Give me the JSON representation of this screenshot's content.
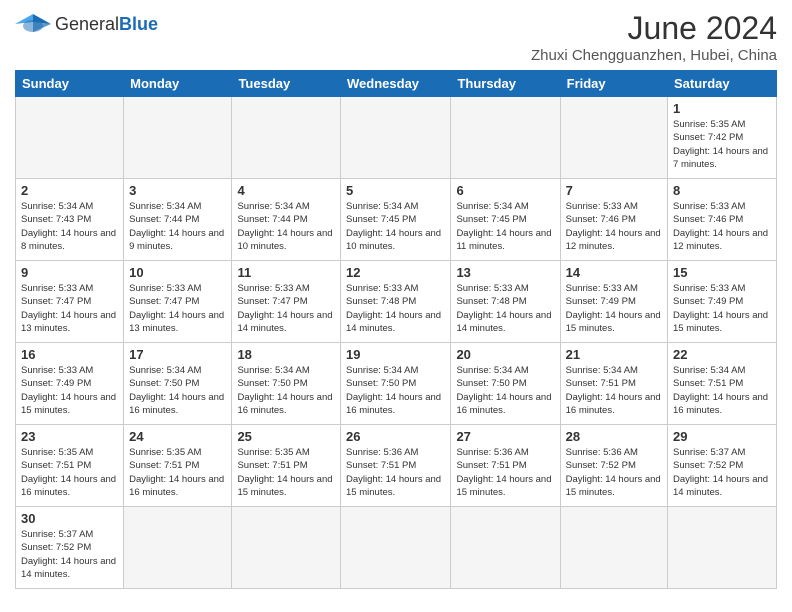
{
  "header": {
    "logo_general": "General",
    "logo_blue": "Blue",
    "month_year": "June 2024",
    "location": "Zhuxi Chengguanzhen, Hubei, China"
  },
  "weekdays": [
    "Sunday",
    "Monday",
    "Tuesday",
    "Wednesday",
    "Thursday",
    "Friday",
    "Saturday"
  ],
  "weeks": [
    [
      {
        "day": "",
        "info": ""
      },
      {
        "day": "",
        "info": ""
      },
      {
        "day": "",
        "info": ""
      },
      {
        "day": "",
        "info": ""
      },
      {
        "day": "",
        "info": ""
      },
      {
        "day": "",
        "info": ""
      },
      {
        "day": "1",
        "info": "Sunrise: 5:35 AM\nSunset: 7:42 PM\nDaylight: 14 hours\nand 7 minutes."
      }
    ],
    [
      {
        "day": "2",
        "info": "Sunrise: 5:34 AM\nSunset: 7:43 PM\nDaylight: 14 hours\nand 8 minutes."
      },
      {
        "day": "3",
        "info": "Sunrise: 5:34 AM\nSunset: 7:44 PM\nDaylight: 14 hours\nand 9 minutes."
      },
      {
        "day": "4",
        "info": "Sunrise: 5:34 AM\nSunset: 7:44 PM\nDaylight: 14 hours\nand 10 minutes."
      },
      {
        "day": "5",
        "info": "Sunrise: 5:34 AM\nSunset: 7:45 PM\nDaylight: 14 hours\nand 10 minutes."
      },
      {
        "day": "6",
        "info": "Sunrise: 5:34 AM\nSunset: 7:45 PM\nDaylight: 14 hours\nand 11 minutes."
      },
      {
        "day": "7",
        "info": "Sunrise: 5:33 AM\nSunset: 7:46 PM\nDaylight: 14 hours\nand 12 minutes."
      },
      {
        "day": "8",
        "info": "Sunrise: 5:33 AM\nSunset: 7:46 PM\nDaylight: 14 hours\nand 12 minutes."
      }
    ],
    [
      {
        "day": "9",
        "info": "Sunrise: 5:33 AM\nSunset: 7:47 PM\nDaylight: 14 hours\nand 13 minutes."
      },
      {
        "day": "10",
        "info": "Sunrise: 5:33 AM\nSunset: 7:47 PM\nDaylight: 14 hours\nand 13 minutes."
      },
      {
        "day": "11",
        "info": "Sunrise: 5:33 AM\nSunset: 7:47 PM\nDaylight: 14 hours\nand 14 minutes."
      },
      {
        "day": "12",
        "info": "Sunrise: 5:33 AM\nSunset: 7:48 PM\nDaylight: 14 hours\nand 14 minutes."
      },
      {
        "day": "13",
        "info": "Sunrise: 5:33 AM\nSunset: 7:48 PM\nDaylight: 14 hours\nand 14 minutes."
      },
      {
        "day": "14",
        "info": "Sunrise: 5:33 AM\nSunset: 7:49 PM\nDaylight: 14 hours\nand 15 minutes."
      },
      {
        "day": "15",
        "info": "Sunrise: 5:33 AM\nSunset: 7:49 PM\nDaylight: 14 hours\nand 15 minutes."
      }
    ],
    [
      {
        "day": "16",
        "info": "Sunrise: 5:33 AM\nSunset: 7:49 PM\nDaylight: 14 hours\nand 15 minutes."
      },
      {
        "day": "17",
        "info": "Sunrise: 5:34 AM\nSunset: 7:50 PM\nDaylight: 14 hours\nand 16 minutes."
      },
      {
        "day": "18",
        "info": "Sunrise: 5:34 AM\nSunset: 7:50 PM\nDaylight: 14 hours\nand 16 minutes."
      },
      {
        "day": "19",
        "info": "Sunrise: 5:34 AM\nSunset: 7:50 PM\nDaylight: 14 hours\nand 16 minutes."
      },
      {
        "day": "20",
        "info": "Sunrise: 5:34 AM\nSunset: 7:50 PM\nDaylight: 14 hours\nand 16 minutes."
      },
      {
        "day": "21",
        "info": "Sunrise: 5:34 AM\nSunset: 7:51 PM\nDaylight: 14 hours\nand 16 minutes."
      },
      {
        "day": "22",
        "info": "Sunrise: 5:34 AM\nSunset: 7:51 PM\nDaylight: 14 hours\nand 16 minutes."
      }
    ],
    [
      {
        "day": "23",
        "info": "Sunrise: 5:35 AM\nSunset: 7:51 PM\nDaylight: 14 hours\nand 16 minutes."
      },
      {
        "day": "24",
        "info": "Sunrise: 5:35 AM\nSunset: 7:51 PM\nDaylight: 14 hours\nand 16 minutes."
      },
      {
        "day": "25",
        "info": "Sunrise: 5:35 AM\nSunset: 7:51 PM\nDaylight: 14 hours\nand 15 minutes."
      },
      {
        "day": "26",
        "info": "Sunrise: 5:36 AM\nSunset: 7:51 PM\nDaylight: 14 hours\nand 15 minutes."
      },
      {
        "day": "27",
        "info": "Sunrise: 5:36 AM\nSunset: 7:51 PM\nDaylight: 14 hours\nand 15 minutes."
      },
      {
        "day": "28",
        "info": "Sunrise: 5:36 AM\nSunset: 7:52 PM\nDaylight: 14 hours\nand 15 minutes."
      },
      {
        "day": "29",
        "info": "Sunrise: 5:37 AM\nSunset: 7:52 PM\nDaylight: 14 hours\nand 14 minutes."
      }
    ],
    [
      {
        "day": "30",
        "info": "Sunrise: 5:37 AM\nSunset: 7:52 PM\nDaylight: 14 hours\nand 14 minutes."
      },
      {
        "day": "",
        "info": ""
      },
      {
        "day": "",
        "info": ""
      },
      {
        "day": "",
        "info": ""
      },
      {
        "day": "",
        "info": ""
      },
      {
        "day": "",
        "info": ""
      },
      {
        "day": "",
        "info": ""
      }
    ]
  ]
}
